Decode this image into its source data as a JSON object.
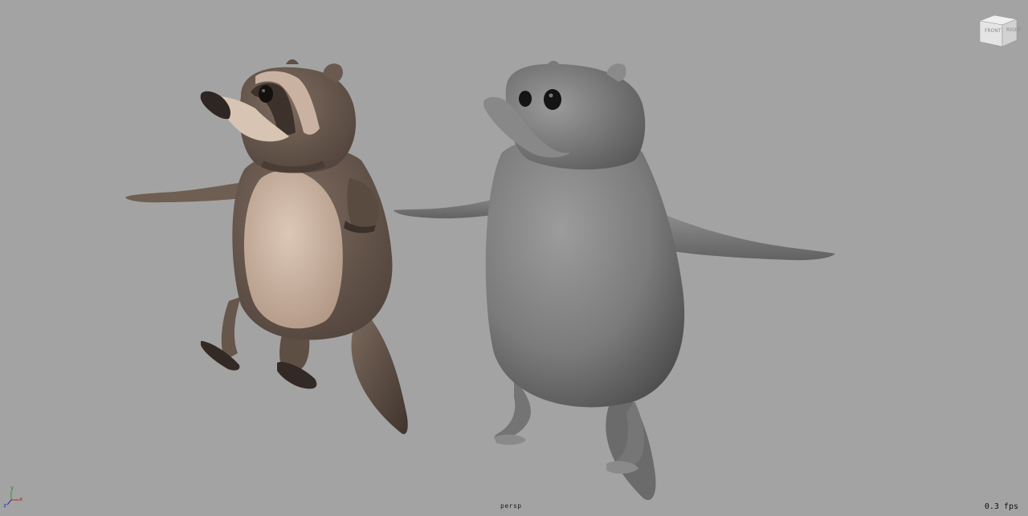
{
  "viewport": {
    "camera": "persp",
    "fps_display": "0.3 fps",
    "background_color": "#a3a3a3"
  },
  "view_cube": {
    "front": "FRONT",
    "right": "RIGHT"
  },
  "axis": {
    "x": "x",
    "y": "y",
    "z": "z"
  },
  "models": [
    {
      "name": "textured-raccoon",
      "shading": "textured",
      "colors": {
        "fur": "#6b5a4f",
        "belly": "#ccb4a2",
        "dark": "#3e332c"
      }
    },
    {
      "name": "untextured-raccoon",
      "shading": "untextured",
      "colors": {
        "surface": "#7c7c7c"
      }
    }
  ]
}
